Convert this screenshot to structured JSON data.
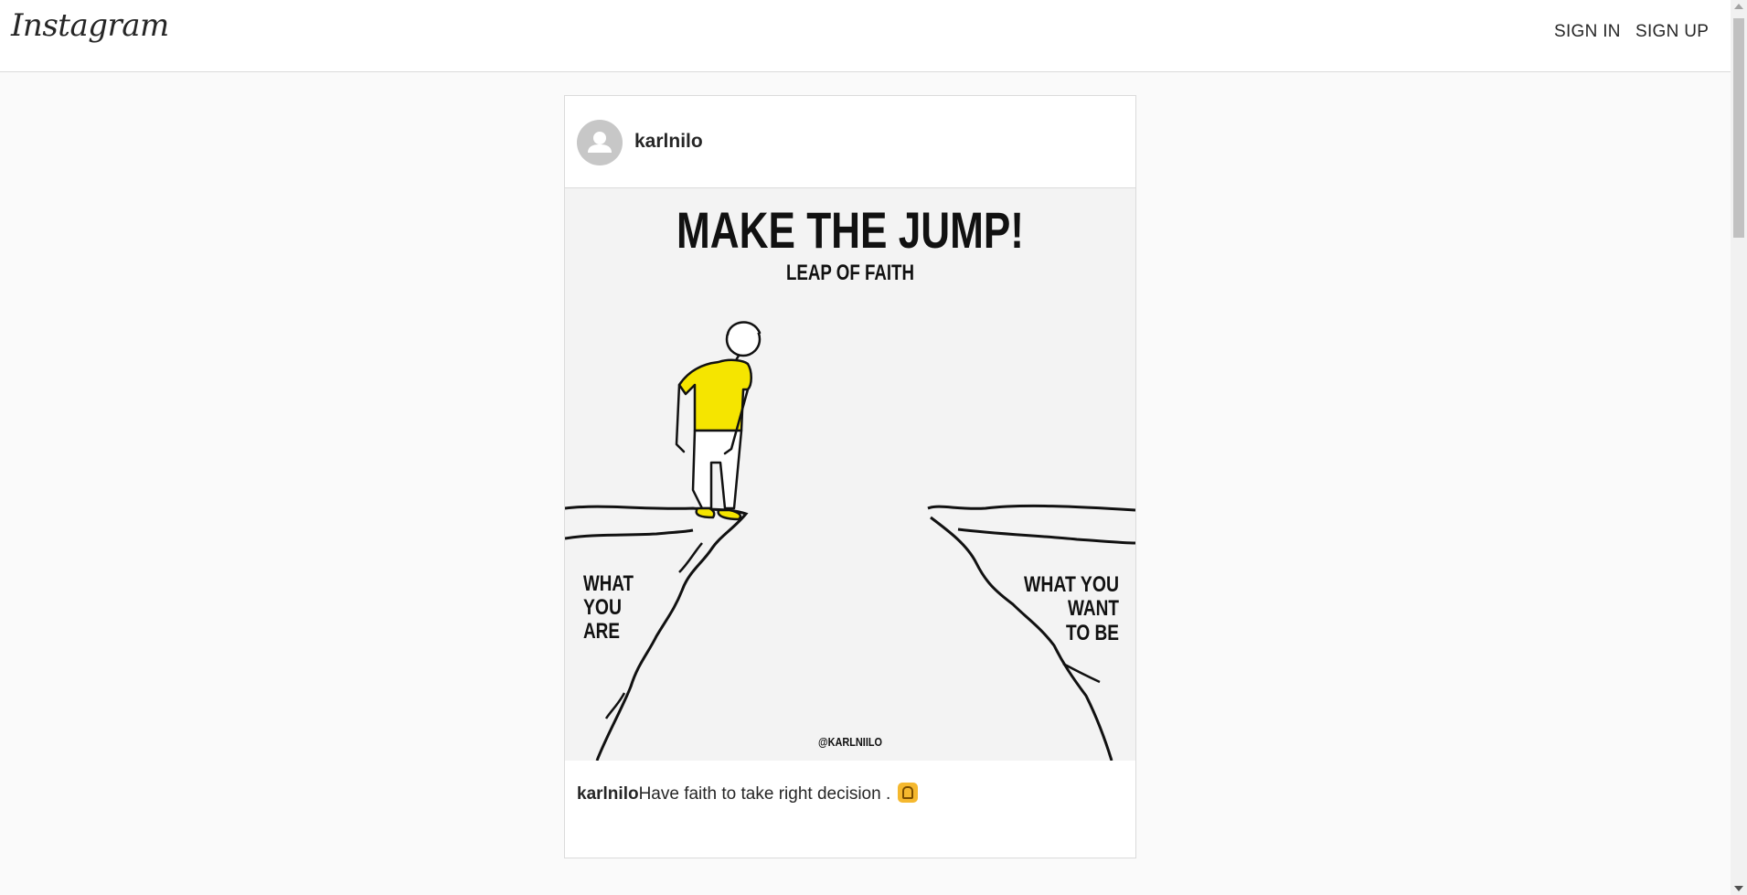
{
  "header": {
    "logo_text": "Instagram",
    "sign_in_label": "SIGN IN",
    "sign_up_label": "SIGN UP"
  },
  "post": {
    "username": "karlnilo",
    "image": {
      "title": "MAKE THE JUMP!",
      "subtitle": "LEAP OF FAITH",
      "left_cliff_label": [
        "WHAT",
        "YOU",
        "ARE"
      ],
      "right_cliff_label": [
        "WHAT YOU",
        "WANT",
        "TO BE"
      ],
      "credit": "@KARLNIILO",
      "shirt_color": "#f5e500"
    },
    "caption_user": "karlnilo",
    "caption_text": "Have faith to take right decision .",
    "caption_emoji_icon": "raising-hands-icon"
  },
  "colors": {
    "background": "#fafafa",
    "border": "#dbdbdb",
    "text": "#262626"
  }
}
